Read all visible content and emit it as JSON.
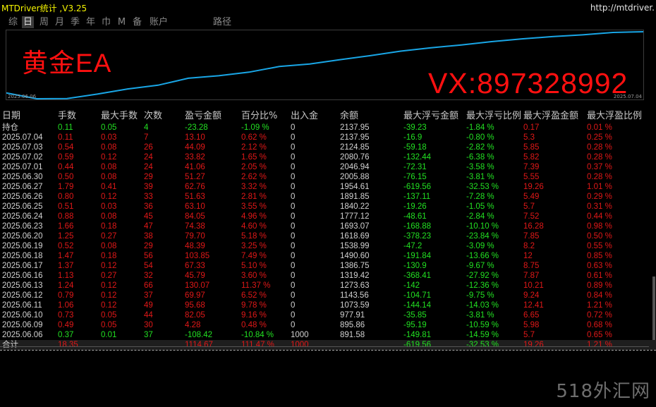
{
  "app": {
    "title": "MTDriver统计 ,V3.25",
    "link": "http://mtdriver."
  },
  "toolbar": {
    "items": [
      "综",
      "日",
      "周",
      "月",
      "季",
      "年",
      "巾",
      "M",
      "备",
      "账户",
      "路径"
    ],
    "active": "日"
  },
  "chart": {
    "badge": "黄金EA",
    "contact": "VX:897328992",
    "date_start": "2025.06.06",
    "date_end": "2025.07.04",
    "line_color": "#19a6e6"
  },
  "chart_data": {
    "type": "line",
    "x": [
      "2025.06.06",
      "2025.06.09",
      "2025.06.10",
      "2025.06.11",
      "2025.06.12",
      "2025.06.13",
      "2025.06.16",
      "2025.06.17",
      "2025.06.18",
      "2025.06.19",
      "2025.06.20",
      "2025.06.23",
      "2025.06.24",
      "2025.06.25",
      "2025.06.26",
      "2025.06.27",
      "2025.06.30",
      "2025.07.01",
      "2025.07.02",
      "2025.07.03",
      "2025.07.04"
    ],
    "series": [
      {
        "values": [
          891.58,
          895.86,
          977.91,
          1073.59,
          1143.56,
          1273.63,
          1319.42,
          1386.75,
          1490.6,
          1538.99,
          1618.69,
          1693.07,
          1777.12,
          1840.22,
          1891.85,
          1954.61,
          2005.88,
          2046.94,
          2080.76,
          2124.85,
          2137.95
        ]
      }
    ]
  },
  "table": {
    "headers": [
      "日期",
      "手数",
      "最大手数",
      "次数",
      "盈亏金额",
      "百分比%",
      "出入金",
      "余额",
      "最大浮亏金额",
      "最大浮亏比例",
      "最大浮盈金额",
      "最大浮盈比例"
    ],
    "holding": {
      "date": "持仓",
      "lots": "0.11",
      "max_lots": "0.05",
      "count": "4",
      "pnl": "-23.28",
      "pct": "-1.09 %",
      "flow": "0",
      "balance": "2137.95",
      "max_float_loss": "-39.23",
      "max_float_loss_pct": "-1.84 %",
      "max_float_profit": "0.17",
      "max_float_profit_pct": "0.01 %"
    },
    "rows": [
      {
        "date": "2025.07.04",
        "lots": "0.11",
        "max_lots": "0.03",
        "count": "7",
        "pnl": "13.10",
        "pct": "0.62 %",
        "flow": "0",
        "balance": "2137.95",
        "max_float_loss": "-16.9",
        "max_float_loss_pct": "-0.80 %",
        "max_float_profit": "5.3",
        "max_float_profit_pct": "0.25 %"
      },
      {
        "date": "2025.07.03",
        "lots": "0.54",
        "max_lots": "0.08",
        "count": "26",
        "pnl": "44.09",
        "pct": "2.12 %",
        "flow": "0",
        "balance": "2124.85",
        "max_float_loss": "-59.18",
        "max_float_loss_pct": "-2.82 %",
        "max_float_profit": "5.85",
        "max_float_profit_pct": "0.28 %"
      },
      {
        "date": "2025.07.02",
        "lots": "0.59",
        "max_lots": "0.12",
        "count": "24",
        "pnl": "33.82",
        "pct": "1.65 %",
        "flow": "0",
        "balance": "2080.76",
        "max_float_loss": "-132.44",
        "max_float_loss_pct": "-6.38 %",
        "max_float_profit": "5.82",
        "max_float_profit_pct": "0.28 %"
      },
      {
        "date": "2025.07.01",
        "lots": "0.44",
        "max_lots": "0.08",
        "count": "24",
        "pnl": "41.06",
        "pct": "2.05 %",
        "flow": "0",
        "balance": "2046.94",
        "max_float_loss": "-72.31",
        "max_float_loss_pct": "-3.58 %",
        "max_float_profit": "7.39",
        "max_float_profit_pct": "0.37 %"
      },
      {
        "date": "2025.06.30",
        "lots": "0.50",
        "max_lots": "0.08",
        "count": "29",
        "pnl": "51.27",
        "pct": "2.62 %",
        "flow": "0",
        "balance": "2005.88",
        "max_float_loss": "-76.15",
        "max_float_loss_pct": "-3.81 %",
        "max_float_profit": "5.55",
        "max_float_profit_pct": "0.28 %"
      },
      {
        "date": "2025.06.27",
        "lots": "1.79",
        "max_lots": "0.41",
        "count": "39",
        "pnl": "62.76",
        "pct": "3.32 %",
        "flow": "0",
        "balance": "1954.61",
        "max_float_loss": "-619.56",
        "max_float_loss_pct": "-32.53 %",
        "max_float_profit": "19.26",
        "max_float_profit_pct": "1.01 %"
      },
      {
        "date": "2025.06.26",
        "lots": "0.80",
        "max_lots": "0.12",
        "count": "33",
        "pnl": "51.63",
        "pct": "2.81 %",
        "flow": "0",
        "balance": "1891.85",
        "max_float_loss": "-137.11",
        "max_float_loss_pct": "-7.28 %",
        "max_float_profit": "5.49",
        "max_float_profit_pct": "0.29 %"
      },
      {
        "date": "2025.06.25",
        "lots": "0.51",
        "max_lots": "0.03",
        "count": "36",
        "pnl": "63.10",
        "pct": "3.55 %",
        "flow": "0",
        "balance": "1840.22",
        "max_float_loss": "-19.26",
        "max_float_loss_pct": "-1.05 %",
        "max_float_profit": "5.7",
        "max_float_profit_pct": "0.31 %"
      },
      {
        "date": "2025.06.24",
        "lots": "0.88",
        "max_lots": "0.08",
        "count": "45",
        "pnl": "84.05",
        "pct": "4.96 %",
        "flow": "0",
        "balance": "1777.12",
        "max_float_loss": "-48.61",
        "max_float_loss_pct": "-2.84 %",
        "max_float_profit": "7.52",
        "max_float_profit_pct": "0.44 %"
      },
      {
        "date": "2025.06.23",
        "lots": "1.66",
        "max_lots": "0.18",
        "count": "47",
        "pnl": "74.38",
        "pct": "4.60 %",
        "flow": "0",
        "balance": "1693.07",
        "max_float_loss": "-168.88",
        "max_float_loss_pct": "-10.10 %",
        "max_float_profit": "16.28",
        "max_float_profit_pct": "0.98 %"
      },
      {
        "date": "2025.06.20",
        "lots": "1.25",
        "max_lots": "0.27",
        "count": "38",
        "pnl": "79.70",
        "pct": "5.18 %",
        "flow": "0",
        "balance": "1618.69",
        "max_float_loss": "-378.23",
        "max_float_loss_pct": "-23.84 %",
        "max_float_profit": "7.85",
        "max_float_profit_pct": "0.50 %"
      },
      {
        "date": "2025.06.19",
        "lots": "0.52",
        "max_lots": "0.08",
        "count": "29",
        "pnl": "48.39",
        "pct": "3.25 %",
        "flow": "0",
        "balance": "1538.99",
        "max_float_loss": "-47.2",
        "max_float_loss_pct": "-3.09 %",
        "max_float_profit": "8.2",
        "max_float_profit_pct": "0.55 %"
      },
      {
        "date": "2025.06.18",
        "lots": "1.47",
        "max_lots": "0.18",
        "count": "56",
        "pnl": "103.85",
        "pct": "7.49 %",
        "flow": "0",
        "balance": "1490.60",
        "max_float_loss": "-191.84",
        "max_float_loss_pct": "-13.66 %",
        "max_float_profit": "12",
        "max_float_profit_pct": "0.85 %"
      },
      {
        "date": "2025.06.17",
        "lots": "1.37",
        "max_lots": "0.12",
        "count": "54",
        "pnl": "67.33",
        "pct": "5.10 %",
        "flow": "0",
        "balance": "1386.75",
        "max_float_loss": "-130.9",
        "max_float_loss_pct": "-9.67 %",
        "max_float_profit": "8.75",
        "max_float_profit_pct": "0.63 %"
      },
      {
        "date": "2025.06.16",
        "lots": "1.13",
        "max_lots": "0.27",
        "count": "32",
        "pnl": "45.79",
        "pct": "3.60 %",
        "flow": "0",
        "balance": "1319.42",
        "max_float_loss": "-368.41",
        "max_float_loss_pct": "-27.92 %",
        "max_float_profit": "7.87",
        "max_float_profit_pct": "0.61 %"
      },
      {
        "date": "2025.06.13",
        "lots": "1.24",
        "max_lots": "0.12",
        "count": "66",
        "pnl": "130.07",
        "pct": "11.37 %",
        "flow": "0",
        "balance": "1273.63",
        "max_float_loss": "-142",
        "max_float_loss_pct": "-12.36 %",
        "max_float_profit": "10.21",
        "max_float_profit_pct": "0.89 %"
      },
      {
        "date": "2025.06.12",
        "lots": "0.79",
        "max_lots": "0.12",
        "count": "37",
        "pnl": "69.97",
        "pct": "6.52 %",
        "flow": "0",
        "balance": "1143.56",
        "max_float_loss": "-104.71",
        "max_float_loss_pct": "-9.75 %",
        "max_float_profit": "9.24",
        "max_float_profit_pct": "0.84 %"
      },
      {
        "date": "2025.06.11",
        "lots": "1.06",
        "max_lots": "0.12",
        "count": "49",
        "pnl": "95.68",
        "pct": "9.78 %",
        "flow": "0",
        "balance": "1073.59",
        "max_float_loss": "-144.14",
        "max_float_loss_pct": "-14.03 %",
        "max_float_profit": "12.41",
        "max_float_profit_pct": "1.21 %"
      },
      {
        "date": "2025.06.10",
        "lots": "0.73",
        "max_lots": "0.05",
        "count": "44",
        "pnl": "82.05",
        "pct": "9.16 %",
        "flow": "0",
        "balance": "977.91",
        "max_float_loss": "-35.85",
        "max_float_loss_pct": "-3.81 %",
        "max_float_profit": "6.65",
        "max_float_profit_pct": "0.72 %"
      },
      {
        "date": "2025.06.09",
        "lots": "0.49",
        "max_lots": "0.05",
        "count": "30",
        "pnl": "4.28",
        "pct": "0.48 %",
        "flow": "0",
        "balance": "895.86",
        "max_float_loss": "-95.19",
        "max_float_loss_pct": "-10.59 %",
        "max_float_profit": "5.98",
        "max_float_profit_pct": "0.68 %"
      },
      {
        "date": "2025.06.06",
        "lots": "0.37",
        "max_lots": "0.01",
        "count": "37",
        "pnl": "-108.42",
        "pct": "-10.84 %",
        "flow": "1000",
        "balance": "891.58",
        "max_float_loss": "-149.81",
        "max_float_loss_pct": "-14.59 %",
        "max_float_profit": "5.7",
        "max_float_profit_pct": "0.65 %"
      }
    ],
    "total": {
      "date": "合计",
      "lots": "18.35",
      "max_lots": "",
      "count": "",
      "pnl": "1114.67",
      "pct": "111.47 %",
      "flow": "1000",
      "balance": "",
      "max_float_loss": "-619.56",
      "max_float_loss_pct": "-32.53 %",
      "max_float_profit": "19.26",
      "max_float_profit_pct": "1.21 %"
    }
  },
  "watermark": "518外汇网",
  "colors": {
    "positive": "#e01818",
    "negative": "#22e022",
    "header": "#c8c8c8"
  }
}
